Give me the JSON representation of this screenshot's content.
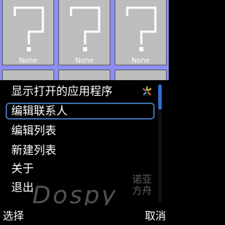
{
  "background_grid": {
    "tiles": [
      {
        "caption": ""
      },
      {
        "caption": ""
      },
      {
        "caption": ""
      },
      {
        "caption": "None"
      },
      {
        "caption": "None"
      },
      {
        "caption": "None"
      }
    ]
  },
  "menu": {
    "items": [
      {
        "label": "显示打开的应用程序",
        "selected": false
      },
      {
        "label": "编辑联系人",
        "selected": true
      },
      {
        "label": "编辑列表",
        "selected": false
      },
      {
        "label": "新建列表",
        "selected": false
      },
      {
        "label": "关于",
        "selected": false
      },
      {
        "label": "退出",
        "selected": false
      }
    ]
  },
  "watermark": {
    "brand": "Dospy",
    "cn_line1": "诺亚",
    "cn_line2": "方舟"
  },
  "softkeys": {
    "left": "选择",
    "right": "取消"
  },
  "colors": {
    "grid_background": "#8c8ef5",
    "tile": "#bdbdbd",
    "selection_border": "#3c6fae",
    "scrollbar_thumb": "#2e6fd6"
  }
}
